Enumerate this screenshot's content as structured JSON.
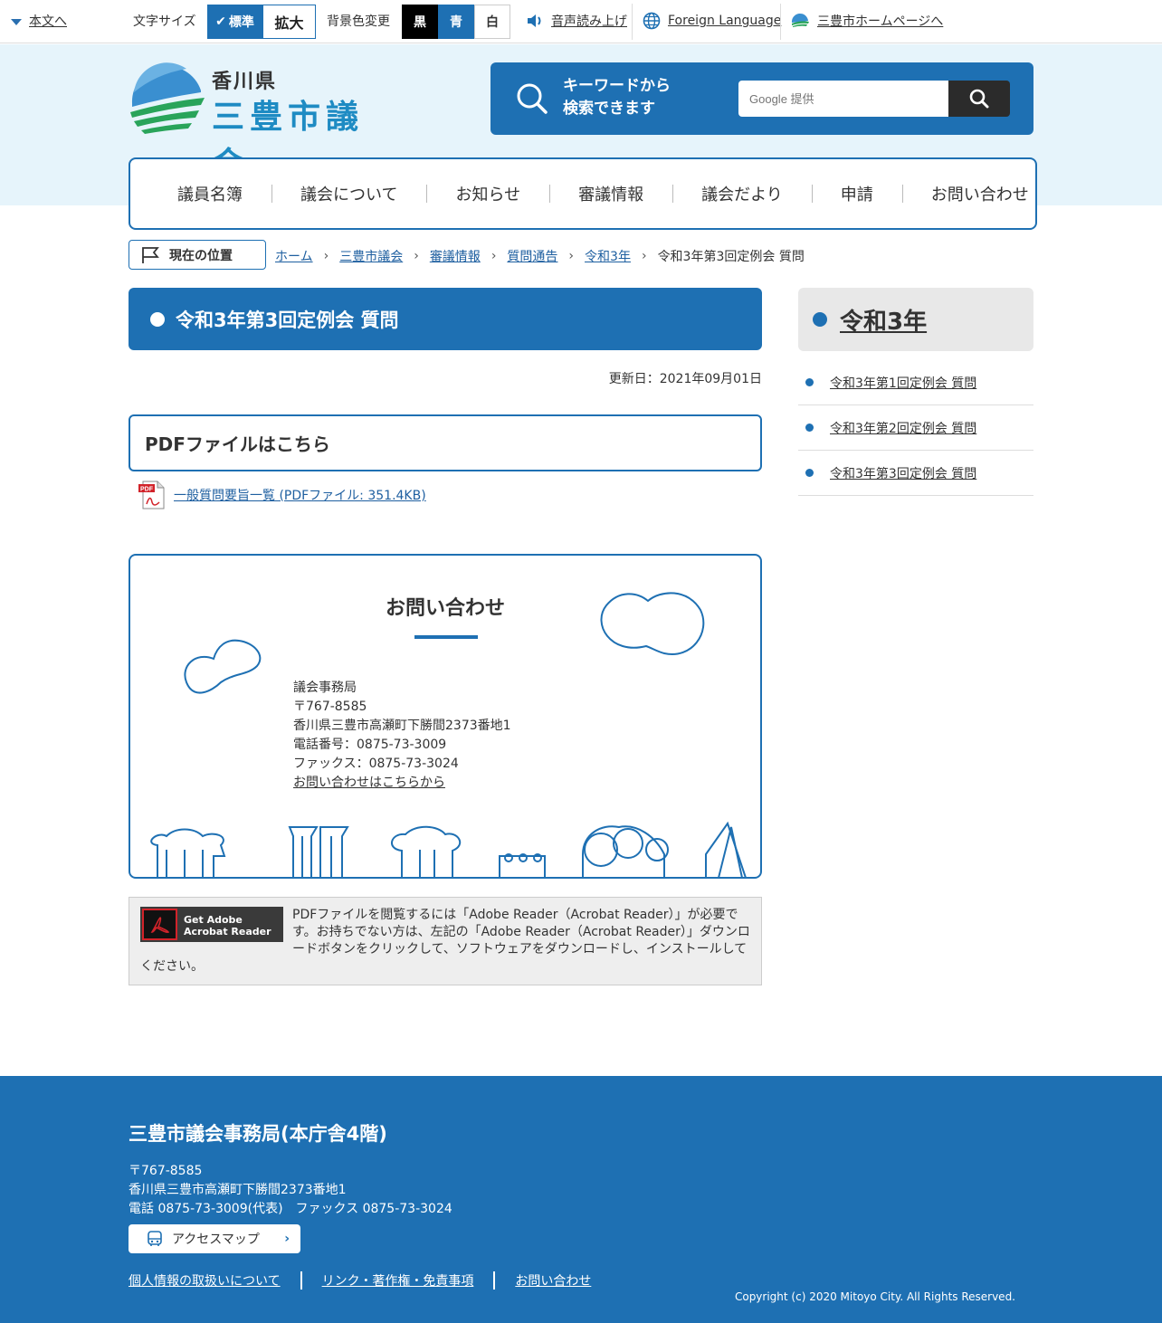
{
  "topbar": {
    "skip_link": "本文へ",
    "font_size_label": "文字サイズ",
    "font_standard": "標準",
    "font_large": "拡大",
    "bg_label": "背景色変更",
    "bg_black": "黒",
    "bg_blue": "青",
    "bg_white": "白",
    "read_aloud": "音声読み上げ",
    "foreign_language": "Foreign Language",
    "city_home": "三豊市ホームページへ"
  },
  "header": {
    "logo_pref": "香川県",
    "logo_name": "三豊市議会",
    "search_label_line1": "キーワードから",
    "search_label_line2": "検索できます",
    "search_placeholder": "Google 提供"
  },
  "nav": {
    "items": [
      "議員名簿",
      "議会について",
      "お知らせ",
      "審議情報",
      "議会だより",
      "申請",
      "お問い合わせ"
    ]
  },
  "breadcrumb": {
    "label": "現在の位置",
    "links": [
      "ホーム",
      "三豊市議会",
      "審議情報",
      "質問通告",
      "令和3年"
    ],
    "current": "令和3年第3回定例会 質問"
  },
  "main": {
    "title": "令和3年第3回定例会 質問",
    "updated": "更新日：2021年09月01日",
    "pdf_heading": "PDFファイルはこちら",
    "pdf_link": "一般質問要旨一覧 (PDFファイル: 351.4KB)"
  },
  "contact": {
    "title": "お問い合わせ",
    "dept": "議会事務局",
    "postal": "〒767-8585",
    "address": "香川県三豊市高瀬町下勝間2373番地1",
    "phone": "電話番号：0875-73-3009",
    "fax": "ファックス：0875-73-3024",
    "form_link": "お問い合わせはこちらから"
  },
  "adobe": {
    "badge_line1": "Get Adobe",
    "badge_line2": "Acrobat Reader",
    "text": "PDFファイルを閲覧するには「Adobe Reader（Acrobat Reader）」が必要です。お持ちでない方は、左記の「Adobe Reader（Acrobat Reader）」ダウンロードボタンをクリックして、ソフトウェアをダウンロードし、インストールしてください。"
  },
  "sidebar": {
    "heading": "令和3年",
    "items": [
      "令和3年第1回定例会 質問",
      "令和3年第2回定例会 質問",
      "令和3年第3回定例会 質問"
    ]
  },
  "footer": {
    "office": "三豊市議会事務局(本庁舎4階)",
    "postal": "〒767-8585",
    "address": "香川県三豊市高瀬町下勝間2373番地1",
    "phone_fax": "電話 0875-73-3009(代表)　ファックス 0875-73-3024",
    "access_map": "アクセスマップ",
    "links": [
      "個人情報の取扱いについて",
      "リンク・著作権・免責事項",
      "お問い合わせ"
    ],
    "copyright": "Copyright (c) 2020 Mitoyo City. All Rights Reserved."
  },
  "colors": {
    "accent": "#1e70b3",
    "header_bg": "#e6f4fb",
    "footer_bg": "#1e70b3"
  }
}
